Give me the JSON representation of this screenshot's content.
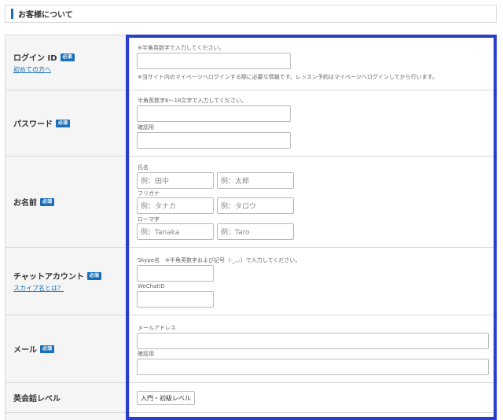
{
  "section": {
    "title": "お客様について"
  },
  "required_badge": "必須",
  "rows": {
    "login": {
      "label": "ログイン ID",
      "link": "初めての方へ",
      "hint": "※半角英数字で入力してください。",
      "note": "※当サイト内のマイページへログインする際に必要な情報です。レッスン予約はマイページへログインしてから行います。"
    },
    "password": {
      "label": "パスワード",
      "hint": "半角英数字6～18文字で入力してください。",
      "confirm_label": "確認用"
    },
    "name": {
      "label": "お名前",
      "kanji_label": "氏名",
      "kanji_last_placeholder": "例：田中",
      "kanji_first_placeholder": "例：太郎",
      "kana_label": "フリガナ",
      "kana_last_placeholder": "例：タナカ",
      "kana_first_placeholder": "例：タロウ",
      "roma_label": "ローマ字",
      "roma_last_placeholder": "例：Tanaka",
      "roma_first_placeholder": "例：Taro"
    },
    "chat": {
      "label": "チャットアカウント",
      "link": "スカイプ名とは？",
      "skype_label": "Skype名　※半角英数字および記号（-_.,:）で入力してください。",
      "wechat_label": "WeChatID"
    },
    "mail": {
      "label": "メール",
      "address_label": "メールアドレス",
      "confirm_label": "確認用"
    },
    "english": {
      "label": "英会話レベル",
      "selected": "入門・初級レベル"
    }
  },
  "colors": {
    "accent": "#1a6fb8",
    "highlight": "#2a3ec9"
  }
}
